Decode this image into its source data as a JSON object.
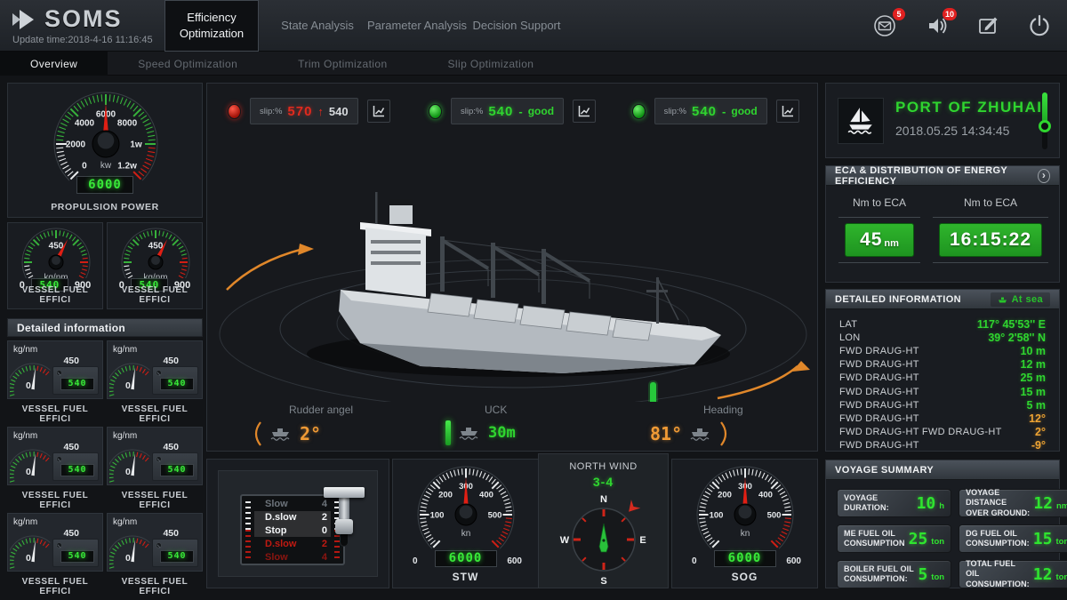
{
  "header": {
    "logo_text": "SOMS",
    "update_time": "Update time:2018-4-16 11:16:45",
    "tabs": [
      {
        "label": "Efficiency Optimization"
      },
      {
        "label": "State Analysis"
      },
      {
        "label": "Parameter Analysis"
      },
      {
        "label": "Decision Support"
      }
    ],
    "mail_badge": "5",
    "sound_badge": "10"
  },
  "subnav": [
    {
      "label": "Overview"
    },
    {
      "label": "Speed Optimization"
    },
    {
      "label": "Trim Optimization"
    },
    {
      "label": "Slip Optimization"
    }
  ],
  "left": {
    "propulsion": {
      "title": "PROPULSION POWER",
      "unit": "kw",
      "readout": "6000",
      "tick_labels": [
        "0",
        "2000",
        "4000",
        "6000",
        "8000",
        "1w",
        "1.2w"
      ]
    },
    "fuel_gauge": {
      "unit": "kg/nm",
      "top": "450",
      "min": "0",
      "max": "900",
      "readout": "540",
      "label": "VESSEL FUEL EFFICI"
    },
    "detail_header": "Detailed information",
    "small_gauge": {
      "unit": "kg/nm",
      "max": "450",
      "min": "0",
      "readout": "540",
      "label": "VESSEL FUEL EFFICI"
    }
  },
  "slip": [
    {
      "label": "slip:%",
      "value": "570",
      "arrow": "↑",
      "ref": "540",
      "status": "alarm"
    },
    {
      "label": "slip:%",
      "value": "540",
      "dash": "-",
      "quality": "good",
      "status": "good"
    },
    {
      "label": "slip:%",
      "value": "540",
      "dash": "-",
      "quality": "good",
      "status": "good"
    }
  ],
  "ship_stats": {
    "rudder": {
      "label": "Rudder angel",
      "value": "2°"
    },
    "uck": {
      "label": "UCK",
      "value": "30m"
    },
    "heading": {
      "label": "Heading",
      "value": "81°"
    }
  },
  "telegraph": {
    "rows": [
      {
        "name": "Slow",
        "num": "4"
      },
      {
        "name": "D.slow",
        "num": "2"
      },
      {
        "name": "Stop",
        "num": "0"
      },
      {
        "name": "D.slow",
        "num": "2"
      },
      {
        "name": "Slow",
        "num": "4"
      }
    ]
  },
  "speed_dials": {
    "tick_labels": [
      "0",
      "100",
      "200",
      "300",
      "400",
      "500",
      "600"
    ],
    "unit": "kn",
    "min": "0",
    "max": "600",
    "stw": {
      "title": "STW",
      "readout": "6000"
    },
    "sog": {
      "title": "SOG",
      "readout": "6000"
    }
  },
  "compass": {
    "title": "NORTH WIND",
    "value": "3-4",
    "n": "N",
    "e": "E",
    "s": "S",
    "w": "W"
  },
  "port": {
    "name": "PORT OF ZHUHAI",
    "time": "2018.05.25 14:34:45"
  },
  "eca": {
    "header": "ECA & DISTRIBUTION OF ENERGY EFFICIENCY",
    "items": [
      {
        "label": "Nm to ECA",
        "value": "45",
        "unit": "nm"
      },
      {
        "label": "Nm to ECA",
        "value": "16:15:22",
        "unit": ""
      }
    ]
  },
  "detail_info": {
    "header": "DETAILED INFORMATION",
    "badge": "At sea",
    "rows": [
      {
        "label": "LAT",
        "value": "117° 45'53'' E",
        "color": "green"
      },
      {
        "label": "LON",
        "value": "39°  2'58'' N",
        "color": "green"
      },
      {
        "label": "FWD DRAUG-HT",
        "value": "10 m",
        "color": "green"
      },
      {
        "label": "FWD DRAUG-HT",
        "value": "12 m",
        "color": "green"
      },
      {
        "label": "FWD DRAUG-HT",
        "value": "25 m",
        "color": "green"
      },
      {
        "label": "FWD DRAUG-HT",
        "value": "15 m",
        "color": "green"
      },
      {
        "label": "FWD DRAUG-HT",
        "value": "5 m",
        "color": "green"
      },
      {
        "label": "FWD DRAUG-HT",
        "value": "12°",
        "color": "orange"
      },
      {
        "label": "FWD DRAUG-HT FWD DRAUG-HT",
        "value": "2°",
        "color": "orange"
      },
      {
        "label": "FWD DRAUG-HT",
        "value": "-9°",
        "color": "orange"
      }
    ]
  },
  "voyage": {
    "header": "VOYAGE SUMMARY",
    "items": [
      {
        "label": "VOYAGE DURATION:",
        "value": "10",
        "unit": "h"
      },
      {
        "label": "VOYAGE DISTANCE OVER GROUND:",
        "value": "12",
        "unit": "nm"
      },
      {
        "label": "ME FUEL OIL CONSUMPTION",
        "value": "25",
        "unit": "ton"
      },
      {
        "label": "DG FUEL OIL CONSUMPTION:",
        "value": "15",
        "unit": "ton"
      },
      {
        "label": "BOILER FUEL OIL CONSUMPTION:",
        "value": "5",
        "unit": "ton"
      },
      {
        "label": "TOTAL FUEL OIL CONSUMPTION:",
        "value": "12",
        "unit": "ton"
      }
    ]
  },
  "colors": {
    "green": "#2fd52f",
    "red": "#d8291f",
    "orange": "#f09a35"
  }
}
